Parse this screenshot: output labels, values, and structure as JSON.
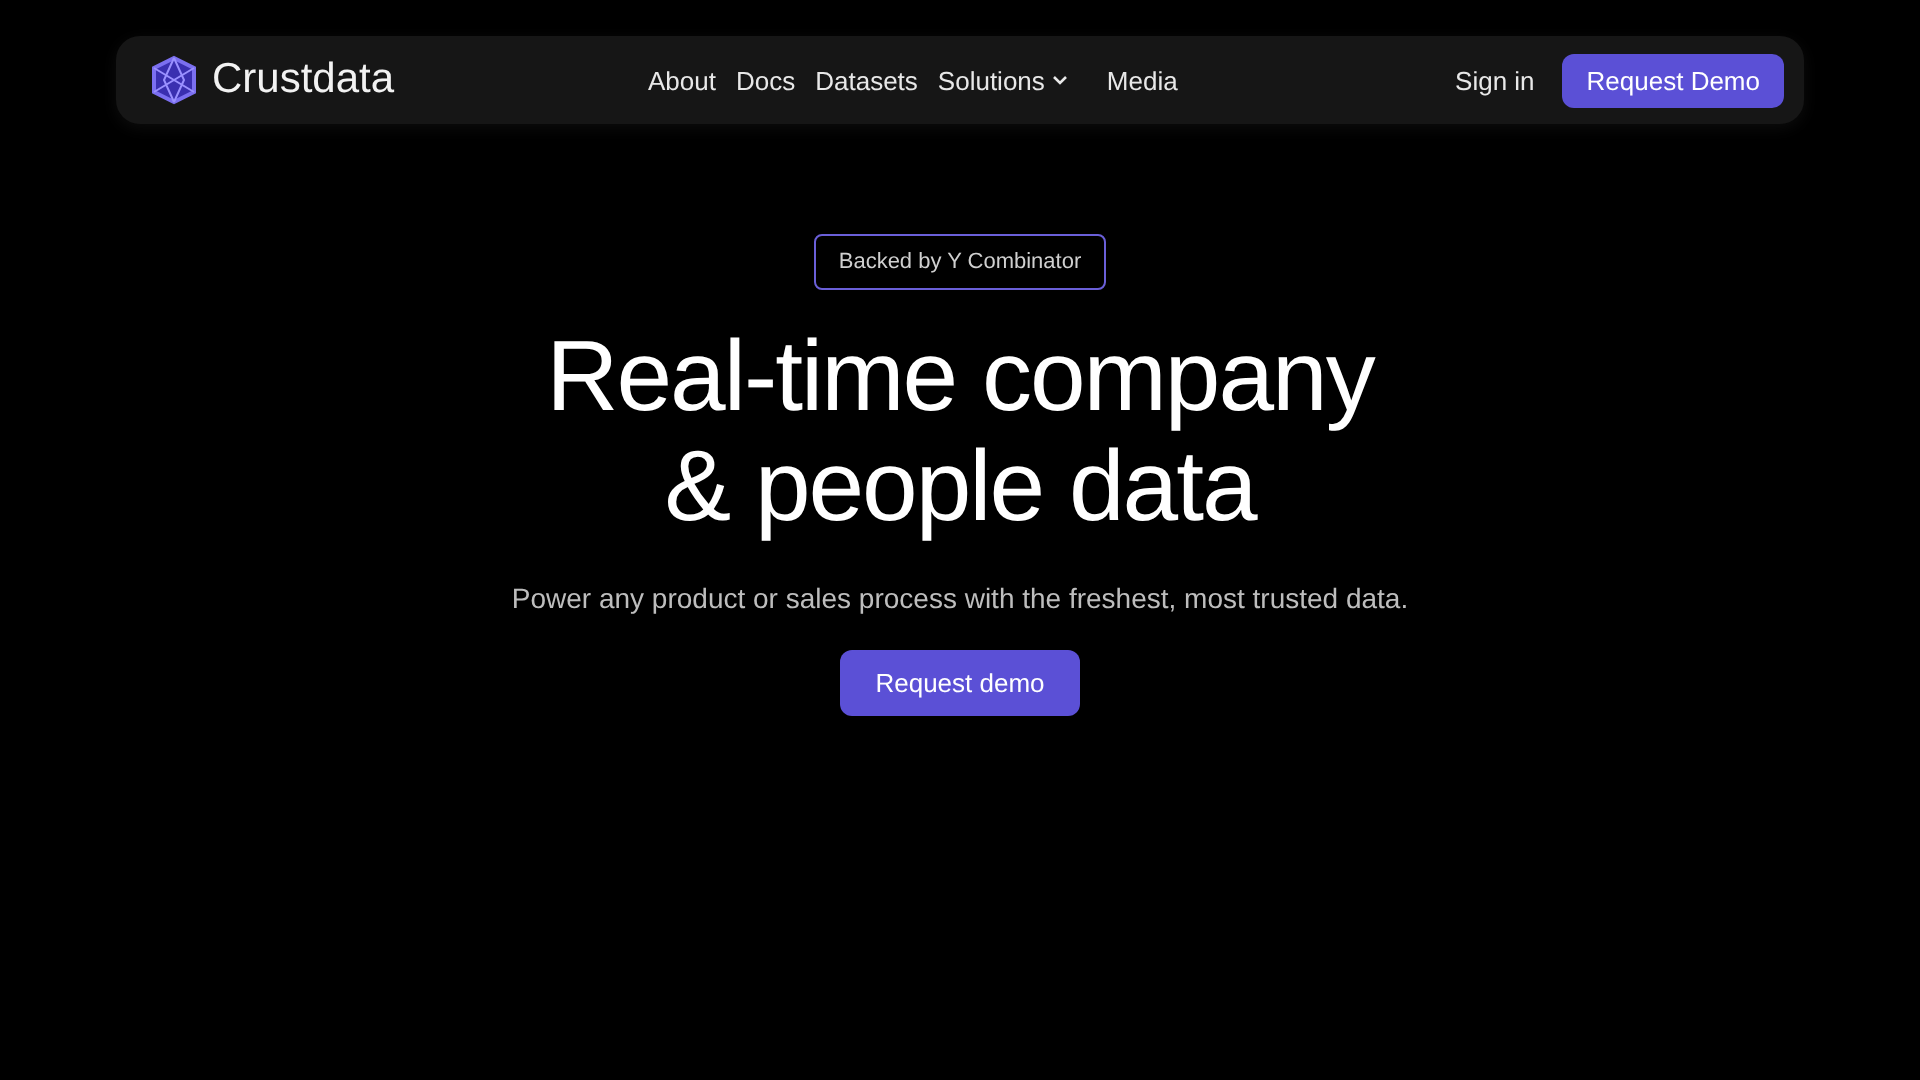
{
  "navbar": {
    "brand": "Crustdata",
    "links": [
      {
        "label": "About",
        "kind": "link"
      },
      {
        "label": "Docs",
        "kind": "link"
      },
      {
        "label": "Datasets",
        "kind": "link"
      },
      {
        "label": "Solutions",
        "kind": "dropdown"
      },
      {
        "label": "Media",
        "kind": "link"
      }
    ],
    "sign_in": "Sign in",
    "cta": "Request Demo"
  },
  "hero": {
    "badge": "Backed by Y Combinator",
    "title_lines": [
      "Real-time company",
      "& people data"
    ],
    "subtitle": "Power any product or sales process with the freshest, most trusted data.",
    "cta": "Request demo"
  }
}
